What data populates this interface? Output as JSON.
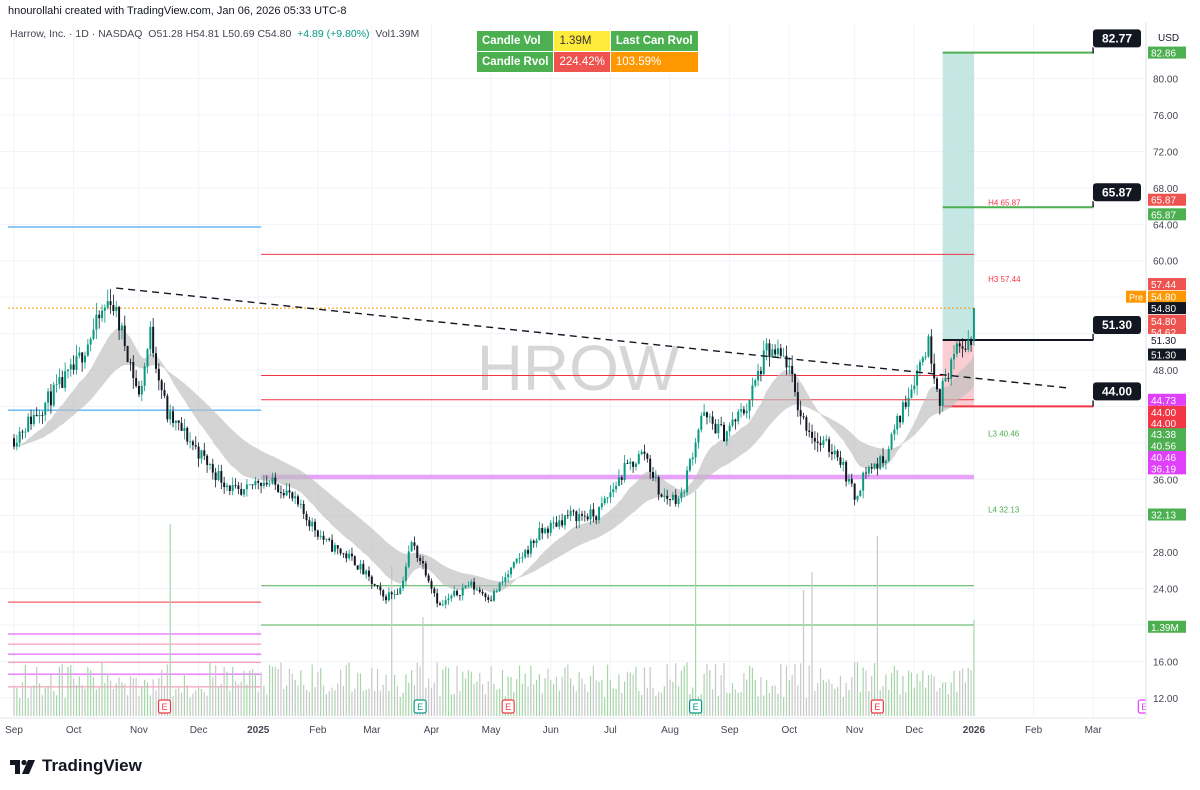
{
  "header": {
    "author_line": "hnourollahi created with TradingView.com, Jan 06, 2026 05:33 UTC-8",
    "symbol": "Harrow, Inc. · 1D · NASDAQ",
    "ohlc": "O51.28 H54.81 L50.69 C54.80",
    "change": "+4.89 (+9.80%)",
    "volume": "Vol1.39M"
  },
  "rvol_table": {
    "candle_vol_label": "Candle Vol",
    "candle_vol_value": "1.39M",
    "last_can_rvol_label": "Last Can Rvol",
    "candle_rvol_label": "Candle Rvol",
    "candle_rvol_value": "224.42%",
    "last_can_rvol_value": "103.59%"
  },
  "watermark": "HROW",
  "brand": "TradingView",
  "currency": "USD",
  "colors": {
    "up": "#089981",
    "down": "#131722",
    "target_zone": "#b2dfdb",
    "stop_zone": "#f8c8cc",
    "green_line": "#4caf50",
    "red_line": "#f23645",
    "blue_line": "#2196f3",
    "magenta": "#e040fb",
    "volume": "#a5d6a7",
    "ema_band": "#bdbdbd"
  },
  "chart_data": {
    "type": "candlestick",
    "symbol": "HROW",
    "ylim": [
      10,
      86
    ],
    "y_ticks": [
      12,
      16,
      20,
      24,
      28,
      32,
      36,
      40,
      44,
      48,
      52,
      56,
      60,
      64,
      68,
      72,
      76,
      80
    ],
    "x_ticks": [
      {
        "label": "Sep",
        "idx": 0
      },
      {
        "label": "Oct",
        "idx": 21
      },
      {
        "label": "Nov",
        "idx": 44
      },
      {
        "label": "Dec",
        "idx": 65
      },
      {
        "label": "2025",
        "idx": 86
      },
      {
        "label": "Feb",
        "idx": 107
      },
      {
        "label": "Mar",
        "idx": 126
      },
      {
        "label": "Apr",
        "idx": 147
      },
      {
        "label": "May",
        "idx": 168
      },
      {
        "label": "Jun",
        "idx": 189
      },
      {
        "label": "Jul",
        "idx": 210
      },
      {
        "label": "Aug",
        "idx": 231
      },
      {
        "label": "Sep",
        "idx": 252
      },
      {
        "label": "Oct",
        "idx": 273
      },
      {
        "label": "Nov",
        "idx": 296
      },
      {
        "label": "Dec",
        "idx": 317
      },
      {
        "label": "2026",
        "idx": 338
      },
      {
        "label": "Feb",
        "idx": 359
      },
      {
        "label": "Mar",
        "idx": 380
      }
    ],
    "path_anchors": [
      [
        0,
        40.5
      ],
      [
        10,
        44
      ],
      [
        21,
        48
      ],
      [
        34,
        56
      ],
      [
        40,
        50
      ],
      [
        44,
        45
      ],
      [
        48,
        52
      ],
      [
        54,
        43
      ],
      [
        60,
        41
      ],
      [
        70,
        37
      ],
      [
        80,
        34
      ],
      [
        86,
        36
      ],
      [
        95,
        35
      ],
      [
        110,
        29
      ],
      [
        120,
        27
      ],
      [
        130,
        23
      ],
      [
        136,
        24
      ],
      [
        140,
        29
      ],
      [
        145,
        26
      ],
      [
        150,
        22
      ],
      [
        160,
        24.5
      ],
      [
        168,
        23
      ],
      [
        175,
        26
      ],
      [
        185,
        30
      ],
      [
        195,
        32
      ],
      [
        205,
        32
      ],
      [
        215,
        37
      ],
      [
        222,
        39
      ],
      [
        228,
        34
      ],
      [
        235,
        34
      ],
      [
        242,
        43
      ],
      [
        250,
        41
      ],
      [
        258,
        44
      ],
      [
        265,
        50
      ],
      [
        272,
        49
      ],
      [
        277,
        43
      ],
      [
        283,
        40
      ],
      [
        290,
        39
      ],
      [
        296,
        34
      ],
      [
        300,
        37
      ],
      [
        306,
        38
      ],
      [
        312,
        43
      ],
      [
        318,
        48
      ],
      [
        322,
        51
      ],
      [
        326,
        45
      ],
      [
        330,
        49
      ],
      [
        335,
        51
      ],
      [
        338,
        51
      ]
    ],
    "last_candle": {
      "open": 51.28,
      "high": 54.81,
      "low": 50.69,
      "close": 54.8,
      "volume": "1.39M"
    },
    "trendline": {
      "from": {
        "idx": 36,
        "price": 57.0
      },
      "to": {
        "idx": 372,
        "price": 46.0
      }
    },
    "levels": {
      "target_2": 82.77,
      "top_zone_edge": 82.86,
      "target_1": 65.87,
      "entry": 51.3,
      "stop": 44.0,
      "h4": 65.87,
      "h3": 57.44,
      "l3": 40.46,
      "l4": 32.13,
      "red_upper": 60.7,
      "red_lower": 44.73,
      "red_mid": 47.4,
      "blue_upper": 63.7,
      "blue_lower": 43.6,
      "magenta_band": [
        36.0,
        36.5
      ],
      "green_upper": 24.3,
      "green_lower": 20.0
    },
    "pivot_labels": [
      {
        "text": "H4 65.87",
        "price": 65.87
      },
      {
        "text": "H3 57.44",
        "price": 57.44
      },
      {
        "text": "L3 40.46",
        "price": 40.46
      },
      {
        "text": "L4 32.13",
        "price": 32.13
      }
    ],
    "callouts": [
      {
        "text": "82.77",
        "price": 82.77
      },
      {
        "text": "65.87",
        "price": 65.87
      },
      {
        "text": "51.30",
        "price": 51.3
      },
      {
        "text": "44.00",
        "price": 44.0
      }
    ],
    "axis_tags": [
      {
        "text": "82.86",
        "price": 82.86,
        "bg": "#4caf50",
        "fg": "#ffffff"
      },
      {
        "text": "65.87",
        "price": 66.7,
        "bg": "#ef5350",
        "fg": "#ffffff"
      },
      {
        "text": "65.87",
        "price": 65.1,
        "bg": "#4caf50",
        "fg": "#ffffff"
      },
      {
        "text": "57.44",
        "price": 57.44,
        "bg": "#ef5350",
        "fg": "#ffffff"
      },
      {
        "text": "54.80",
        "price": 56.05,
        "bg": "#ff9800",
        "fg": "#ffffff",
        "prefix": "Pre"
      },
      {
        "text": "54.80",
        "price": 54.8,
        "bg": "#131722",
        "fg": "#ffffff"
      },
      {
        "text": "54.80",
        "price": 53.4,
        "bg": "#ef5350",
        "fg": "#ffffff"
      },
      {
        "text": "54.62",
        "price": 52.15,
        "bg": "#ef5350",
        "fg": "#ffffff"
      },
      {
        "text": "51.30",
        "price": 51.3,
        "bg": "#ffffff",
        "fg": "#131722"
      },
      {
        "text": "51.30",
        "price": 49.7,
        "bg": "#131722",
        "fg": "#ffffff"
      },
      {
        "text": "44.73",
        "price": 44.73,
        "bg": "#e040fb",
        "fg": "#ffffff"
      },
      {
        "text": "44.00",
        "price": 43.4,
        "bg": "#f23645",
        "fg": "#ffffff"
      },
      {
        "text": "44.00",
        "price": 42.2,
        "bg": "#f23645",
        "fg": "#ffffff"
      },
      {
        "text": "43.38",
        "price": 40.95,
        "bg": "#4caf50",
        "fg": "#ffffff"
      },
      {
        "text": "40.56",
        "price": 39.7,
        "bg": "#4caf50",
        "fg": "#ffffff"
      },
      {
        "text": "40.46",
        "price": 38.45,
        "bg": "#e040fb",
        "fg": "#ffffff"
      },
      {
        "text": "36.19",
        "price": 37.2,
        "bg": "#e040fb",
        "fg": "#ffffff"
      },
      {
        "text": "32.13",
        "price": 32.13,
        "bg": "#4caf50",
        "fg": "#ffffff"
      },
      {
        "text": "1.39M",
        "price": 19.8,
        "bg": "#4caf50",
        "fg": "#ffffff"
      }
    ]
  }
}
